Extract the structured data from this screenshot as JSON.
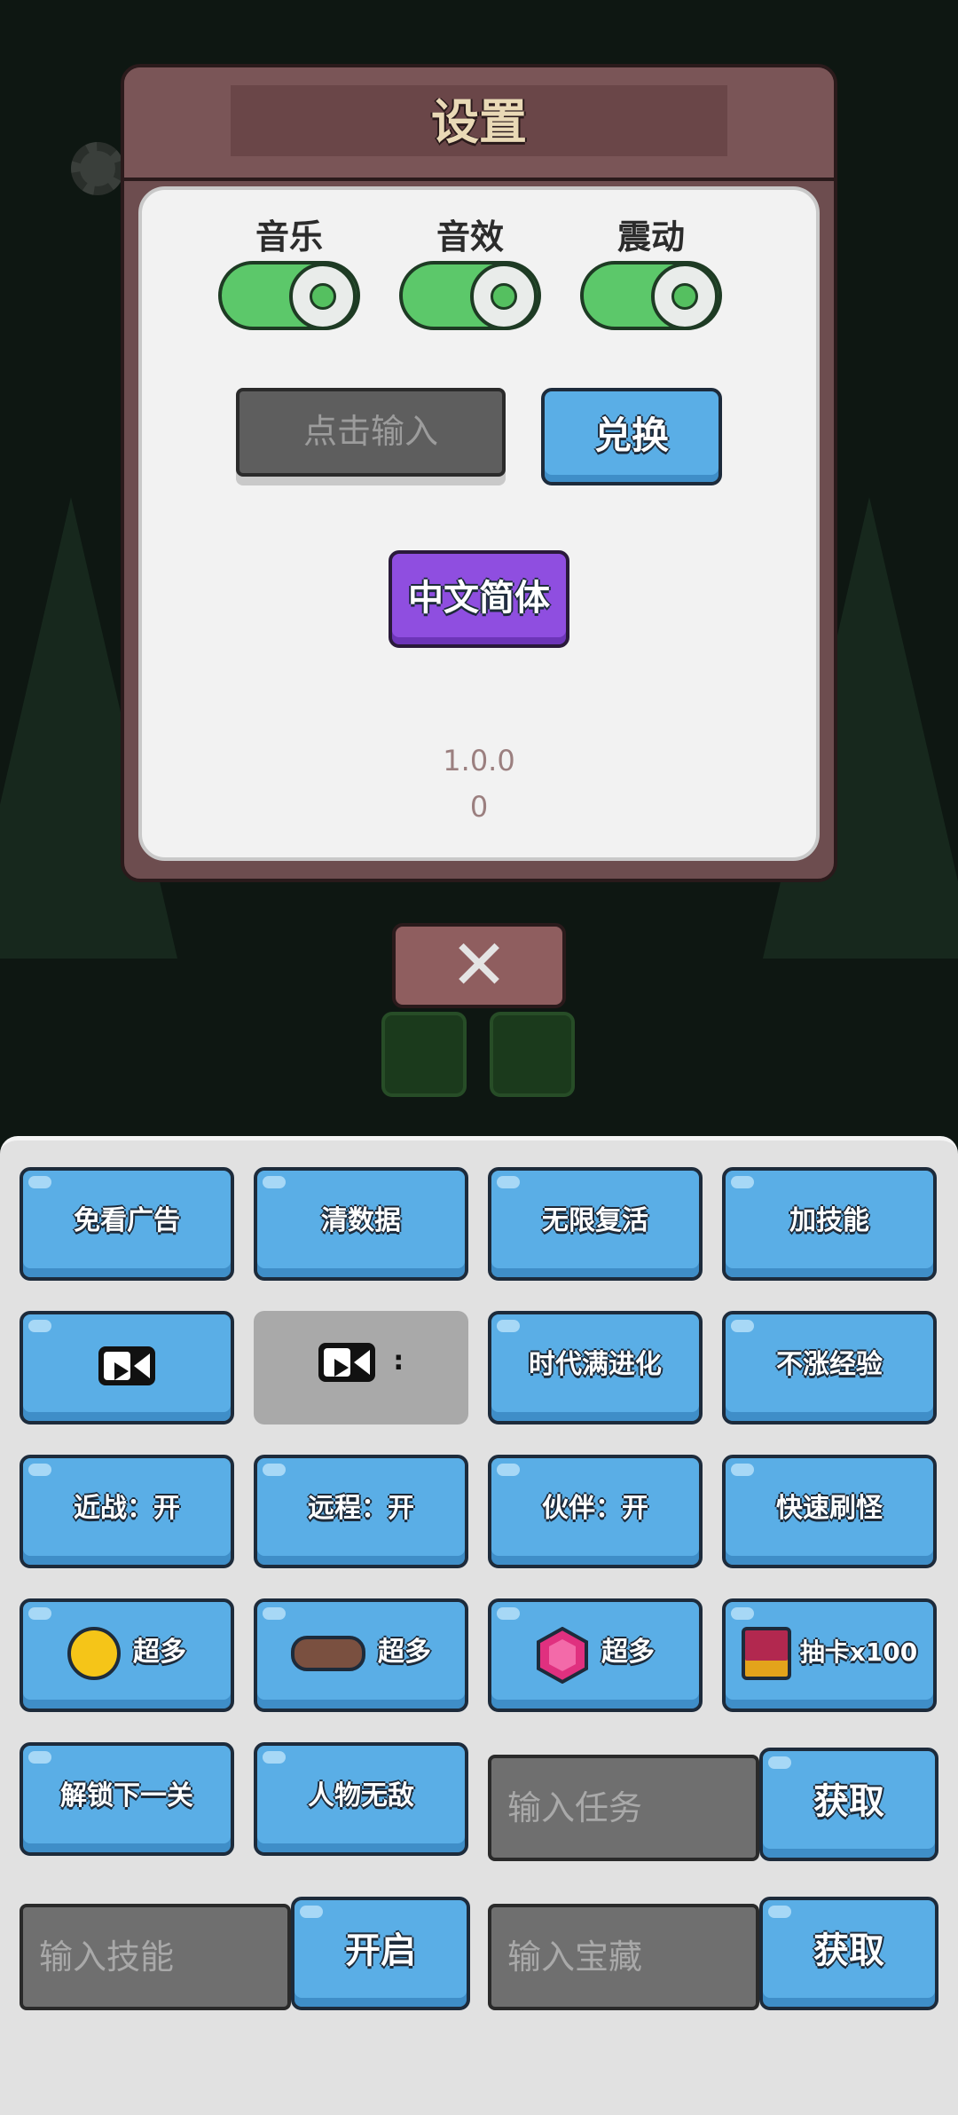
{
  "settings": {
    "title": "设置",
    "toggles": [
      {
        "label": "音乐",
        "on": true
      },
      {
        "label": "音效",
        "on": true
      },
      {
        "label": "震动",
        "on": true
      }
    ],
    "code_input_placeholder": "点击输入",
    "redeem_label": "兑换",
    "language_label": "中文简体",
    "version": "1.0.0",
    "build": "0"
  },
  "colors": {
    "toggle_on": "#5cc86a",
    "button_blue": "#5aaee6",
    "button_purple": "#8f4ee0",
    "dialog_frame": "#6d4d4f"
  },
  "cheat_panel": {
    "row1": [
      "免看广告",
      "清数据",
      "无限复活",
      "加技能"
    ],
    "row2": {
      "video_icon": "video-camera-icon",
      "video_suffix": ":",
      "evolve": "时代满进化",
      "no_exp": "不涨经验"
    },
    "row3": [
      "近战：开",
      "远程：开",
      "伙伴：开",
      "快速刷怪"
    ],
    "row4": [
      {
        "icon": "gold-coin-icon",
        "label": "超多"
      },
      {
        "icon": "wood-log-icon",
        "label": "超多"
      },
      {
        "icon": "pink-gem-icon",
        "label": "超多"
      },
      {
        "icon": "treasure-chest-icon",
        "label": "抽卡x100"
      }
    ],
    "row5": {
      "unlock": "解锁下一关",
      "invincible": "人物无敌",
      "task_placeholder": "输入任务",
      "task_get": "获取"
    },
    "row6": {
      "skill_placeholder": "输入技能",
      "skill_on": "开启",
      "treasure_placeholder": "输入宝藏",
      "treasure_get": "获取"
    }
  }
}
